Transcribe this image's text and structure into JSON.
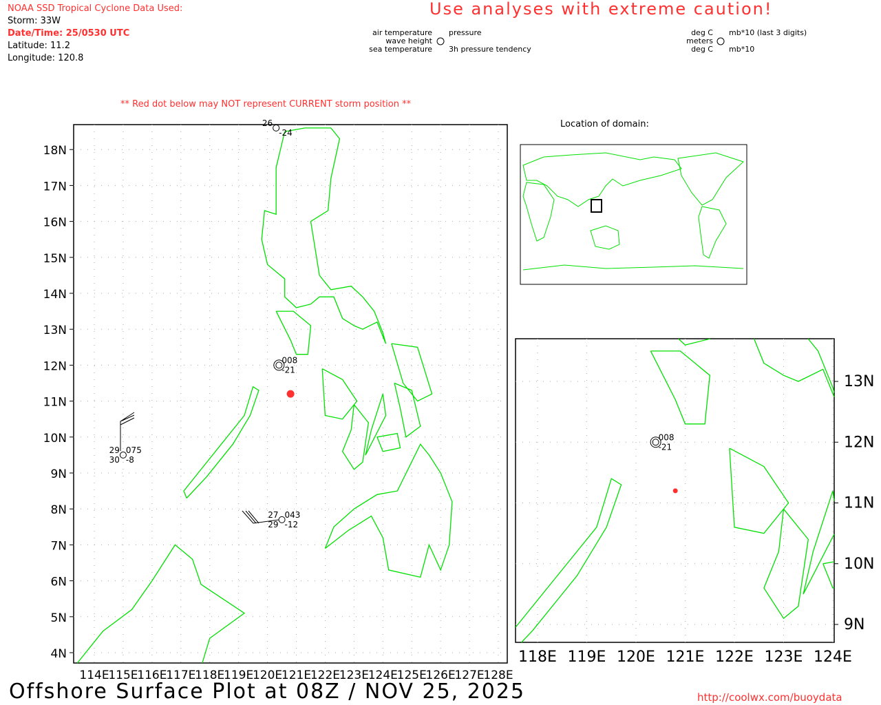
{
  "header": {
    "source_label": "NOAA SSD Tropical Cyclone Data Used:",
    "storm": "Storm: 33W",
    "datetime": "Date/Time: 25/0530 UTC",
    "latitude": "Latitude: 11.2",
    "longitude": "Longitude: 120.8",
    "caution": "Use analyses with extreme caution!",
    "red_dot_note": "** Red dot below may NOT represent CURRENT storm position **"
  },
  "legend": {
    "left": {
      "air_temp": "air temperature",
      "wave_height": "wave height",
      "sea_temp": "sea temperature",
      "pressure": "pressure",
      "tendency": "3h pressure tendency"
    },
    "right": {
      "air_temp": "deg C",
      "wave_height": "meters",
      "sea_temp": "deg C",
      "pressure": "mb*10 (last 3 digits)",
      "tendency": "mb*10"
    }
  },
  "main_map": {
    "lat_labels": [
      "18N",
      "17N",
      "16N",
      "15N",
      "14N",
      "13N",
      "12N",
      "11N",
      "10N",
      "9N",
      "8N",
      "7N",
      "6N",
      "5N",
      "4N"
    ],
    "lon_labels": [
      "114E",
      "115E",
      "116E",
      "117E",
      "118E",
      "119E",
      "120E",
      "121E",
      "122E",
      "123E",
      "124E",
      "125E",
      "126E",
      "127E",
      "128E"
    ],
    "storm_position": {
      "lat": 11.2,
      "lon": 120.8
    }
  },
  "stations": [
    {
      "lat": 18.6,
      "lon": 120.3,
      "air_temp": "26",
      "pressure": "",
      "sea_temp": "",
      "tendency": "-24"
    },
    {
      "lat": 12.0,
      "lon": 120.4,
      "air_temp": "",
      "pressure": "008",
      "sea_temp": "",
      "tendency": "-21"
    },
    {
      "lat": 9.5,
      "lon": 115.0,
      "air_temp": "29",
      "pressure": "075",
      "sea_temp": "30",
      "tendency": "-8"
    },
    {
      "lat": 7.7,
      "lon": 120.5,
      "air_temp": "27",
      "pressure": "043",
      "sea_temp": "29",
      "tendency": "-12"
    }
  ],
  "domain_map": {
    "title": "Location of domain:"
  },
  "zoom_map": {
    "lat_labels": [
      "13N",
      "12N",
      "11N",
      "10N",
      "9N"
    ],
    "lon_labels": [
      "118E",
      "119E",
      "120E",
      "121E",
      "122E",
      "123E",
      "124E"
    ]
  },
  "footer": {
    "title": "Offshore Surface Plot at 08Z / NOV 25, 2025",
    "url": "http://coolwx.com/buoydata"
  },
  "colors": {
    "coast": "#00e000",
    "accent": "#ff3030"
  }
}
